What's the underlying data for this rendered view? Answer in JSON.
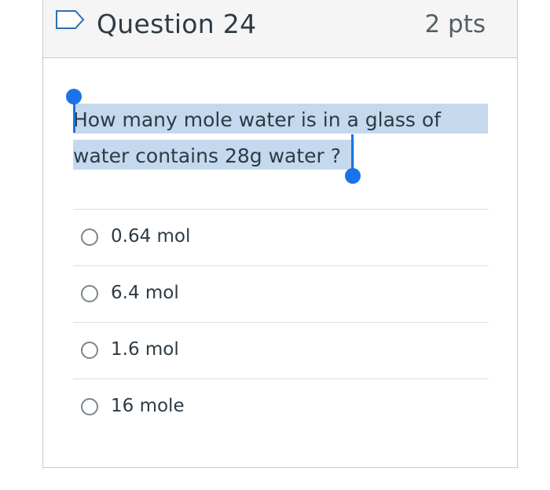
{
  "question": {
    "title": "Question 24",
    "points": "2 pts",
    "text_line1": "How many mole water is in a glass of",
    "text_line2": "water contains 28g water ?",
    "flag_icon": "flag-outline-icon"
  },
  "answers": [
    {
      "label": "0.64 mol"
    },
    {
      "label": "6.4 mol"
    },
    {
      "label": "1.6 mol"
    },
    {
      "label": "16 mole"
    }
  ],
  "colors": {
    "selection_highlight": "#c5d9ee",
    "selection_handle": "#1a73e8",
    "header_background": "#f5f5f5",
    "border": "#c7cdd1"
  }
}
